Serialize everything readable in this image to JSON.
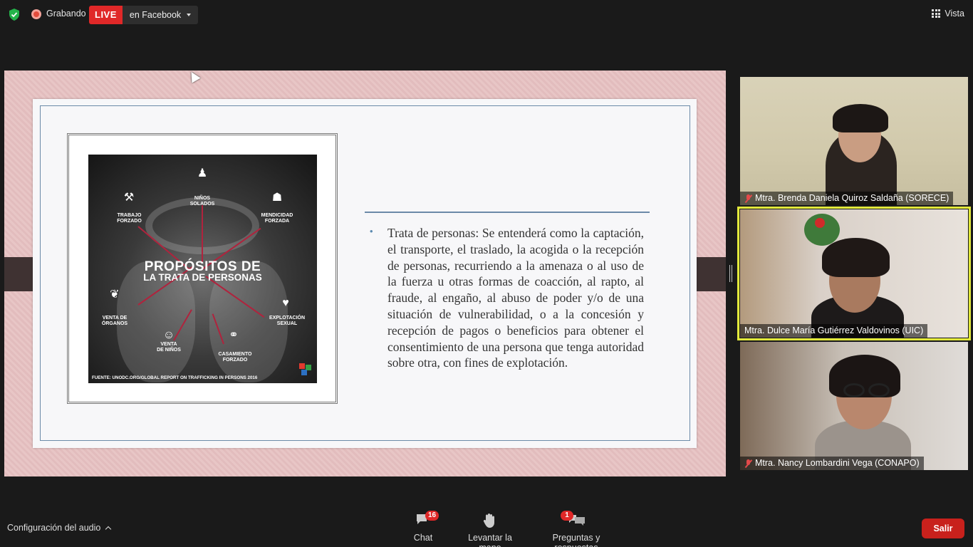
{
  "topbar": {
    "recording_label": "Grabando",
    "live_badge": "LIVE",
    "live_target": "en Facebook",
    "view_label": "Vista"
  },
  "slide": {
    "poster": {
      "title_line1": "PROPÓSITOS DE",
      "title_line2": "LA TRATA DE PERSONAS",
      "labels": {
        "forced_labor": "TRABAJO\nFORZADO",
        "child_soldiers": "NIÑOS\nSOLADOS",
        "forced_begging": "MENDICIDAD\nFORZADA",
        "organ_sale": "VENTA DE\nÓRGANOS",
        "sexual_exploitation": "EXPLOTACIÓN\nSEXUAL",
        "child_sale": "VENTA\nDE NIÑOS",
        "forced_marriage": "CASAMIENTO\nFORZADO"
      },
      "source": "FUENTE: UNODC.ORG/GLOBAL REPORT ON TRAFFICKING IN PERSONS 2016",
      "logo_text": "teleSUR"
    },
    "body_text": "Trata de personas: Se entenderá como la captación, el transporte, el traslado, la acogida o la recepción de personas, recurriendo a la amenaza o al uso de la fuerza u otras formas de coacción, al rapto, al fraude, al engaño, al abuso de poder y/o de una situación de vulnerabilidad, o a la concesión y recepción de pagos o beneficios para obtener el consentimiento de una persona que tenga autoridad sobre otra, con fines de explotación."
  },
  "participants": [
    {
      "name": "Mtra. Brenda Daniela Quiroz Saldaña (SORECE)",
      "muted": true
    },
    {
      "name": "Mtra. Dulce María Gutiérrez Valdovinos  (UIC)",
      "muted": false,
      "active_speaker": true
    },
    {
      "name": "Mtra. Nancy Lombardini Vega (CONAPO)",
      "muted": true
    }
  ],
  "toolbar": {
    "audio_settings": "Configuración del audio",
    "chat_label": "Chat",
    "chat_count": "16",
    "raise_hand_label": "Levantar la mano",
    "qa_label": "Preguntas y respuestas",
    "qa_count": "1",
    "leave_label": "Salir"
  },
  "colors": {
    "live_red": "#e02828",
    "active_speaker_border": "#e2e93b",
    "leave_red": "#c8211c"
  }
}
